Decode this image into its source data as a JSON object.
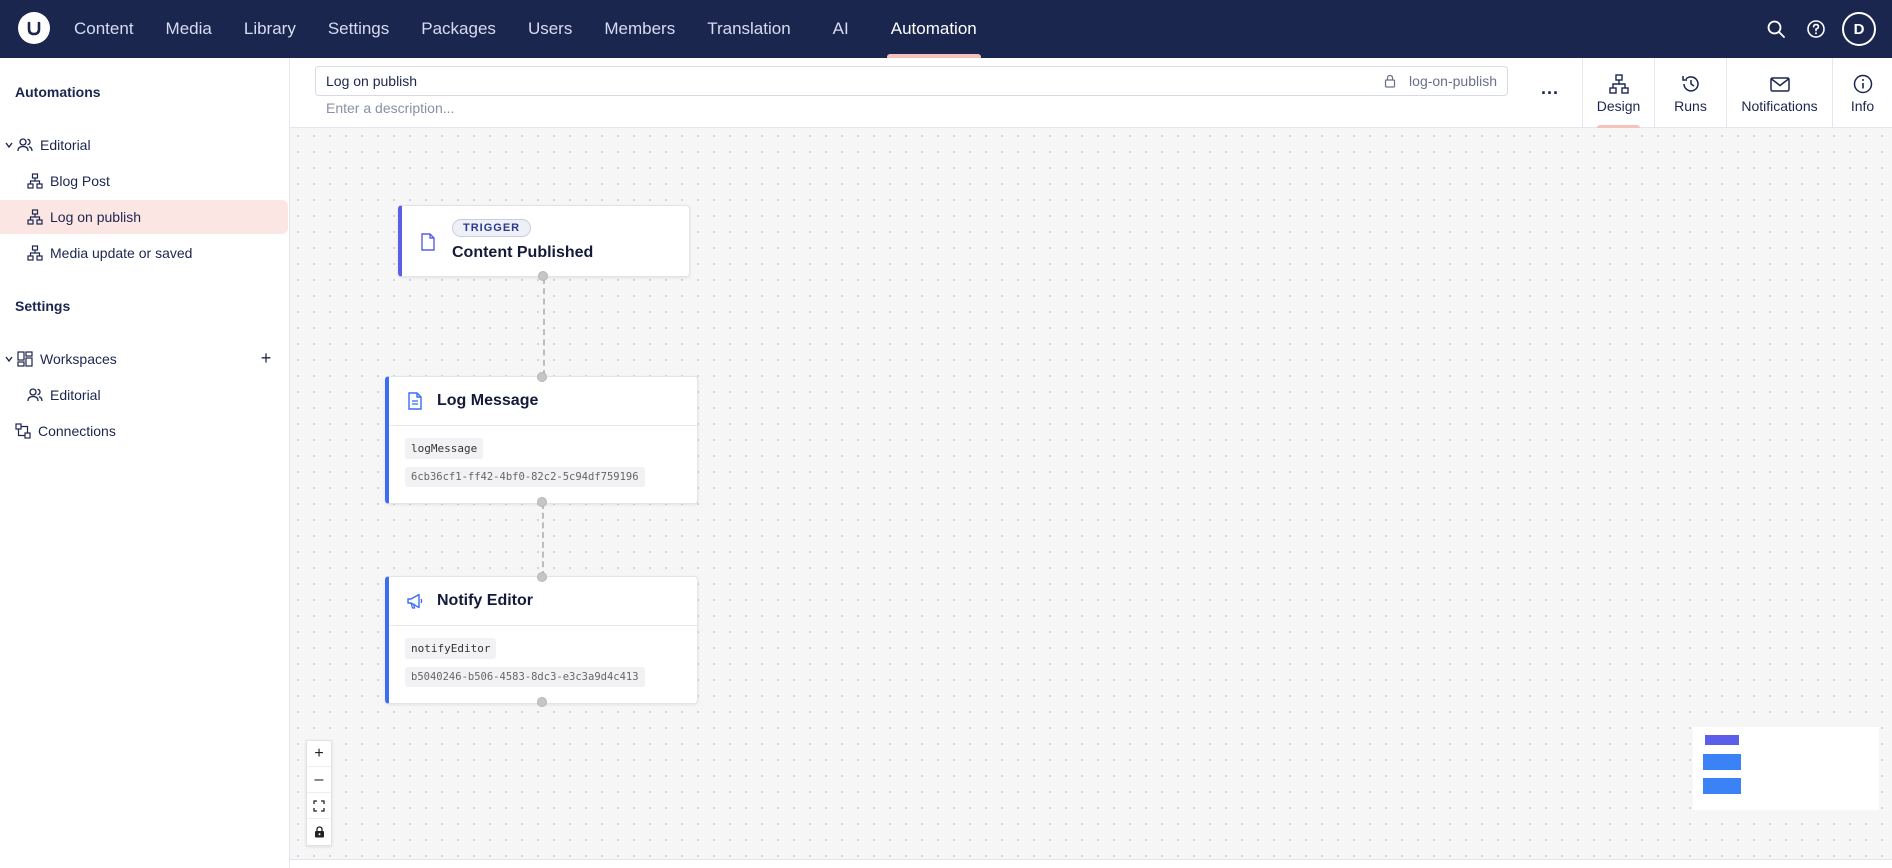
{
  "nav": {
    "items": [
      "Content",
      "Media",
      "Library",
      "Settings",
      "Packages",
      "Users",
      "Members",
      "Translation",
      "AI",
      "Automation"
    ],
    "active": "Automation",
    "avatar_initial": "D"
  },
  "sidebar": {
    "automations_heading": "Automations",
    "group_editorial": "Editorial",
    "items": [
      "Blog Post",
      "Log on publish",
      "Media update or saved"
    ],
    "settings_heading": "Settings",
    "workspaces": "Workspaces",
    "workspace_items": [
      "Editorial"
    ],
    "connections": "Connections"
  },
  "header": {
    "name_value": "Log on publish",
    "alias": "log-on-publish",
    "description_placeholder": "Enter a description...",
    "more": "...",
    "tabs": [
      "Design",
      "Runs",
      "Notifications",
      "Info"
    ],
    "active_tab": "Design"
  },
  "canvas": {
    "trigger": {
      "badge": "TRIGGER",
      "title": "Content Published"
    },
    "log_node": {
      "title": "Log Message",
      "alias": "logMessage",
      "id": "6cb36cf1-ff42-4bf0-82c2-5c94df759196"
    },
    "notify_node": {
      "title": "Notify Editor",
      "alias": "notifyEditor",
      "id": "b5040246-b506-4583-8dc3-e3c3a9d4c413"
    }
  },
  "zoom_controls": [
    "+",
    "–",
    "⛶",
    "🔒"
  ],
  "colors": {
    "nav_bg": "#1b264f",
    "accent": "#3b6ef0",
    "active_highlight": "#fbe6e4",
    "tab_indicator": "#f5c1bc",
    "trigger_accent": "#5a5ee8"
  }
}
